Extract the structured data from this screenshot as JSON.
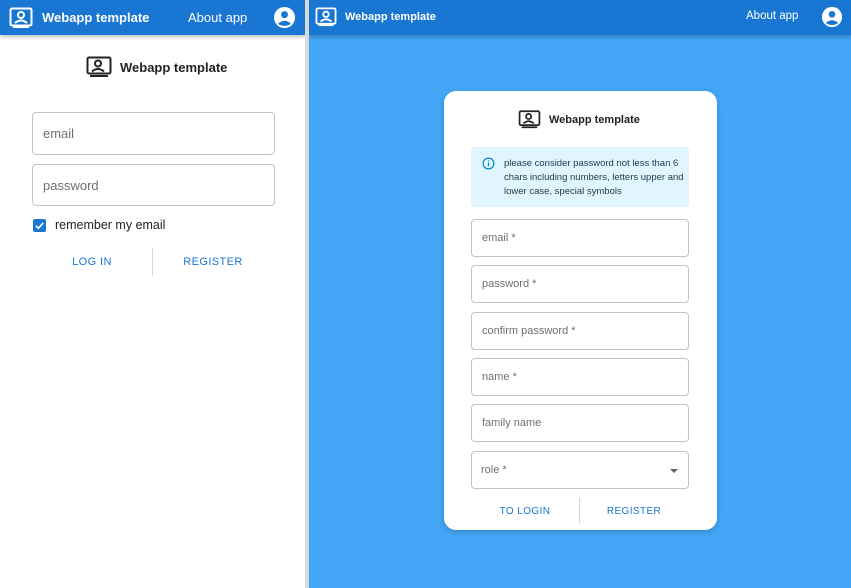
{
  "left": {
    "appbar": {
      "brand": "Webapp template",
      "about": "About app"
    },
    "brand_title": "Webapp template",
    "email_placeholder": "email",
    "password_placeholder": "password",
    "remember_label": "remember my email",
    "remember_checked": true,
    "login_label": "LOG IN",
    "register_label": "REGISTER"
  },
  "right": {
    "appbar": {
      "brand": "Webapp template",
      "about": "About app"
    },
    "brand_title": "Webapp template",
    "alert_text": "please consider password not less than 6 chars including numbers, letters upper and lower case, special symbols",
    "email_placeholder": "email *",
    "password_placeholder": "password *",
    "confirm_placeholder": "confirm password *",
    "name_placeholder": "name *",
    "family_placeholder": "family name",
    "role_label": "role *",
    "to_login_label": "TO LOGIN",
    "register_label": "REGISTER"
  },
  "colors": {
    "appbar": "#1976d2",
    "background_right": "#42a5f5",
    "primary": "#1976d2",
    "alert_bg": "#e1f5fe"
  },
  "icons": {
    "logo": "account-box-outline-icon",
    "account": "account-circle-icon",
    "info": "info-outline-icon",
    "checkbox": "checkbox-checked-icon",
    "dropdown": "arrow-drop-down-icon"
  }
}
